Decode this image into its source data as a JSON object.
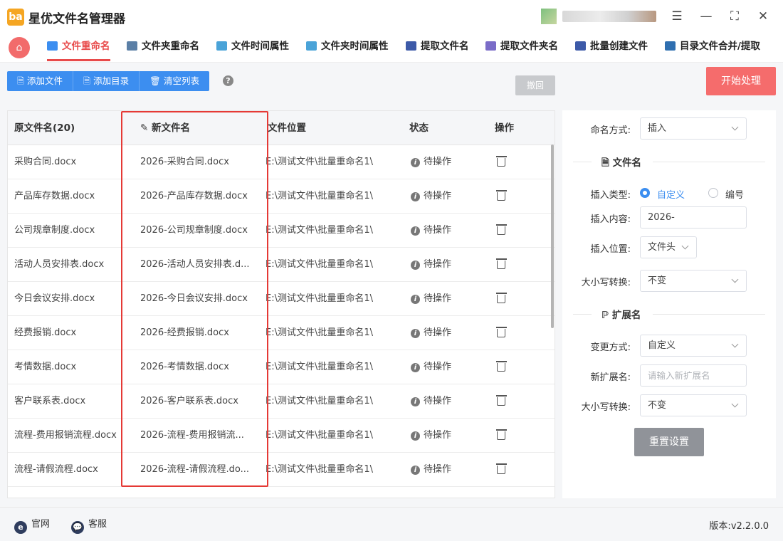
{
  "app": {
    "title": "星优文件名管理器",
    "logo_text": "ba"
  },
  "window_controls": {
    "settings": "☰",
    "minimize": "—",
    "maximize": "⛶",
    "close": "✕"
  },
  "nav": {
    "home_icon": "home-icon",
    "tabs": [
      {
        "label": "文件重命名",
        "active": true,
        "icon_color": "#3c8ef0"
      },
      {
        "label": "文件夹重命名",
        "active": false,
        "icon_color": "#5b7fa6"
      },
      {
        "label": "文件时间属性",
        "active": false,
        "icon_color": "#4aa3d8"
      },
      {
        "label": "文件夹时间属性",
        "active": false,
        "icon_color": "#4aa3d8"
      },
      {
        "label": "提取文件名",
        "active": false,
        "icon_color": "#3d5aa8"
      },
      {
        "label": "提取文件夹名",
        "active": false,
        "icon_color": "#7a6cc8"
      },
      {
        "label": "批量创建文件",
        "active": false,
        "icon_color": "#3d5aa8"
      },
      {
        "label": "目录文件合并/提取",
        "active": false,
        "icon_color": "#2f6fb0"
      }
    ]
  },
  "toolbar": {
    "add_file": "添加文件",
    "add_dir": "添加目录",
    "clear_list": "清空列表",
    "help": "?",
    "undo": "撤回",
    "start": "开始处理"
  },
  "table": {
    "headers": {
      "original": "原文件名(20)",
      "new": "新文件名",
      "path": "文件位置",
      "status": "状态",
      "action": "操作"
    },
    "rows": [
      {
        "original": "采购合同.docx",
        "new": "2026-采购合同.docx",
        "path": "E:\\测试文件\\批量重命名1\\",
        "status": "待操作"
      },
      {
        "original": "产品库存数据.docx",
        "new": "2026-产品库存数据.docx",
        "path": "E:\\测试文件\\批量重命名1\\",
        "status": "待操作"
      },
      {
        "original": "公司规章制度.docx",
        "new": "2026-公司规章制度.docx",
        "path": "E:\\测试文件\\批量重命名1\\",
        "status": "待操作"
      },
      {
        "original": "活动人员安排表.docx",
        "new": "2026-活动人员安排表.d...",
        "path": "E:\\测试文件\\批量重命名1\\",
        "status": "待操作"
      },
      {
        "original": "今日会议安排.docx",
        "new": "2026-今日会议安排.docx",
        "path": "E:\\测试文件\\批量重命名1\\",
        "status": "待操作"
      },
      {
        "original": "经费报销.docx",
        "new": "2026-经费报销.docx",
        "path": "E:\\测试文件\\批量重命名1\\",
        "status": "待操作"
      },
      {
        "original": "考情数据.docx",
        "new": "2026-考情数据.docx",
        "path": "E:\\测试文件\\批量重命名1\\",
        "status": "待操作"
      },
      {
        "original": "客户联系表.docx",
        "new": "2026-客户联系表.docx",
        "path": "E:\\测试文件\\批量重命名1\\",
        "status": "待操作"
      },
      {
        "original": "流程-费用报销流程.docx",
        "new": "2026-流程-费用报销流...",
        "path": "E:\\测试文件\\批量重命名1\\",
        "status": "待操作"
      },
      {
        "original": "流程-请假流程.docx",
        "new": "2026-流程-请假流程.do...",
        "path": "E:\\测试文件\\批量重命名1\\",
        "status": "待操作"
      }
    ]
  },
  "settings": {
    "naming_mode_label": "命名方式:",
    "naming_mode_value": "插入",
    "filename_section": "文件名",
    "insert_type_label": "插入类型:",
    "insert_type_options": [
      "自定义",
      "编号"
    ],
    "insert_type_selected": "自定义",
    "insert_content_label": "插入内容:",
    "insert_content_value": "2026-",
    "insert_position_label": "插入位置:",
    "insert_position_value": "文件头",
    "case_label": "大小写转换:",
    "case_value": "不变",
    "ext_section": "扩展名",
    "change_mode_label": "变更方式:",
    "change_mode_value": "自定义",
    "new_ext_label": "新扩展名:",
    "new_ext_placeholder": "请输入新扩展名",
    "ext_case_label": "大小写转换:",
    "ext_case_value": "不变",
    "reset": "重置设置"
  },
  "footer": {
    "website": "官网",
    "support": "客服",
    "version_label": "版本:",
    "version_value": "v2.2.0.0"
  },
  "colors": {
    "accent": "#e84a4a",
    "primary": "#3c8ef0",
    "start": "#f56c6c",
    "highlight_box": "#e53935"
  }
}
